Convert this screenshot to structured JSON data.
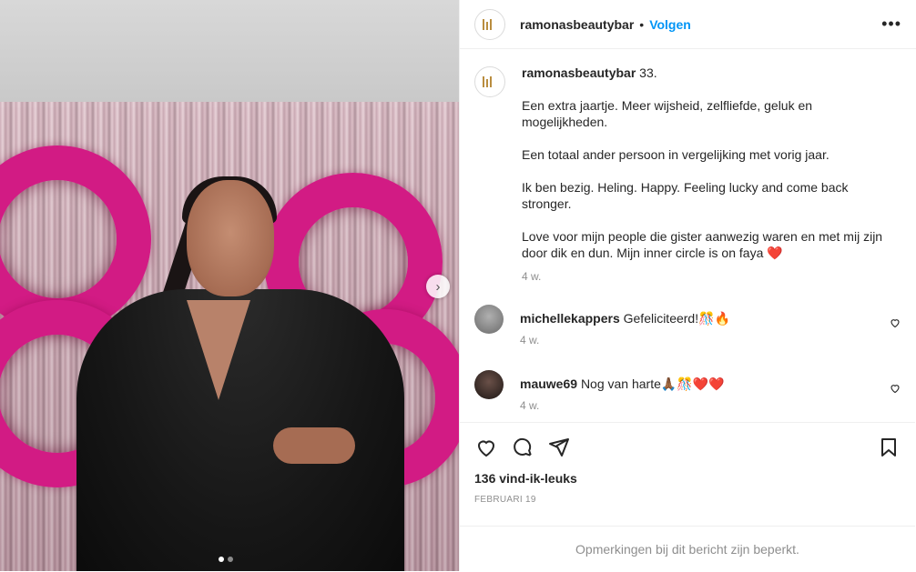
{
  "post": {
    "photo_alt_icons": {
      "next": "chevron-right-icon"
    },
    "carousel": {
      "count": 2,
      "active": 0
    }
  },
  "header": {
    "username": "ramonasbeautybar",
    "separator": "•",
    "follow_label": "Volgen",
    "more_label": "•••"
  },
  "caption": {
    "username": "ramonasbeautybar",
    "first_line": "33.",
    "paragraphs": [
      "Een extra jaartje. Meer wijsheid, zelfliefde, geluk en mogelijkheden.",
      "Een totaal ander persoon in vergelijking met vorig jaar.",
      "Ik ben bezig. Heling. Happy. Feeling lucky and come back stronger.",
      "Love voor mijn people die gister aanwezig waren en met mij zijn door dik en dun. Mijn inner circle is on faya ❤️"
    ],
    "time": "4 w."
  },
  "comments": [
    {
      "username": "michellekappers",
      "text": "Gefeliciteerd!🎊🔥",
      "time": "4 w."
    },
    {
      "username": "mauwe69",
      "text": "Nog van harte🙏🏾🎊❤️❤️",
      "time": "4 w."
    }
  ],
  "actions": {
    "likes": "136 vind-ik-leuks",
    "date": "FEBRUARI 19",
    "restricted": "Opmerkingen bij dit bericht zijn beperkt."
  },
  "colors": {
    "accent": "#0095f6",
    "muted": "#8e8e8e",
    "text": "#262626"
  }
}
